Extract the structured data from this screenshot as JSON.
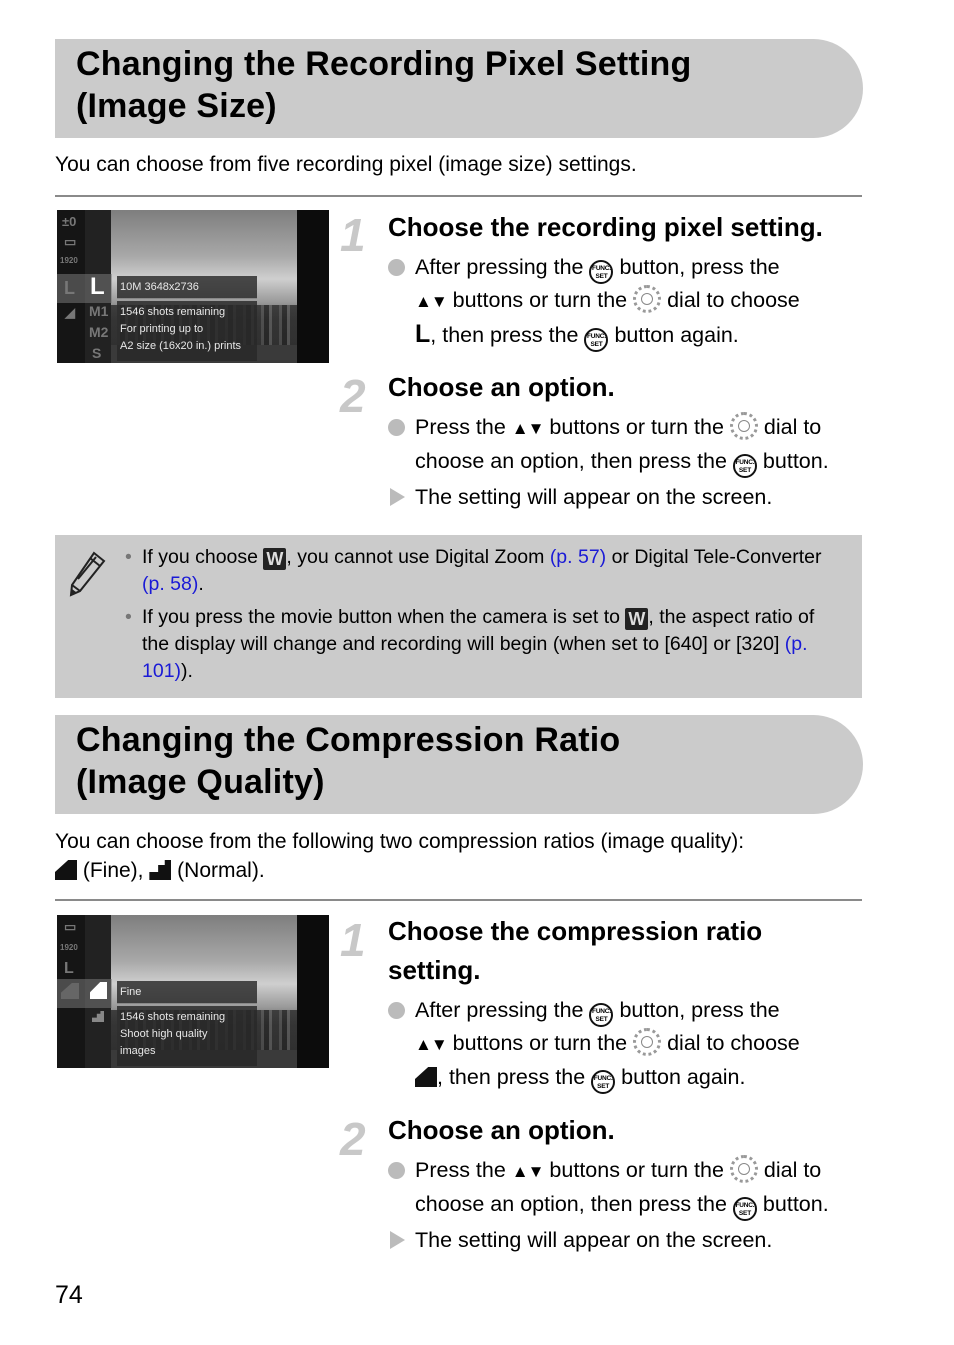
{
  "page_number": "74",
  "colors": {
    "header_bg": "#cbcbcb",
    "link": "#1a1ad6",
    "step_number": "#c8c8c8",
    "rule": "#8a8a8a"
  },
  "section1": {
    "title_line1": "Changing the Recording Pixel Setting",
    "title_line2": "(Image Size)",
    "intro": "You can choose from five recording pixel (image size) settings.",
    "screen": {
      "left_icons": [
        "±0",
        "▭",
        "1920",
        "L",
        "◢"
      ],
      "menu_options": [
        "L",
        "M1",
        "M2",
        "S"
      ],
      "selected_option": "L",
      "info_title": "10M 3648x2736",
      "info_lines": [
        "1546 shots remaining",
        "For printing up to",
        "A2 size (16x20 in.) prints"
      ]
    },
    "step1": {
      "number": "1",
      "heading": "Choose the recording pixel setting.",
      "t1": "After pressing the ",
      "t2": " button, press the",
      "t3": " buttons or turn the ",
      "t4": " dial to choose",
      "t5": ", then press the ",
      "t6": " button again.",
      "choice_glyph": "L"
    },
    "step2": {
      "number": "2",
      "heading": "Choose an option.",
      "t1": "Press the ",
      "t2": " buttons or turn the ",
      "t3": " dial to",
      "t4": "choose an option, then press the ",
      "t5": " button.",
      "result": "The setting will appear on the screen."
    }
  },
  "note": {
    "item1": {
      "t1": "If you choose ",
      "icon": "W",
      "t2": ", you cannot use Digital Zoom ",
      "link1": "(p. 57)",
      "t3": " or Digital Tele-Converter ",
      "link2": "(p. 58)",
      "t4": "."
    },
    "item2": {
      "t1": "If you press the movie button when the camera is set to ",
      "icon": "W",
      "t2": ", the aspect ratio of the display will change and recording will begin (when set to [640] or [320] ",
      "link1": "(p. 101)",
      "t3": ")."
    }
  },
  "section2": {
    "title_line1": "Changing the Compression Ratio",
    "title_line2": "(Image Quality)",
    "intro_t1": "You can choose from the following two compression ratios (image quality):",
    "intro_fine": " (Fine), ",
    "intro_normal": " (Normal).",
    "screen": {
      "left_icons": [
        "▭",
        "1920",
        "L",
        "◢"
      ],
      "menu_options": [
        "Fine",
        "Normal"
      ],
      "selected_option": "Fine",
      "info_title": "Fine",
      "info_lines": [
        "1546 shots remaining",
        "Shoot high quality",
        "images"
      ]
    },
    "step1": {
      "number": "1",
      "heading_line1": "Choose the compression ratio",
      "heading_line2": "setting.",
      "t1": "After pressing the ",
      "t2": " button, press the",
      "t3": " buttons or turn the ",
      "t4": " dial to choose",
      "t5": ", then press the ",
      "t6": " button again."
    },
    "step2": {
      "number": "2",
      "heading": "Choose an option.",
      "t1": "Press the ",
      "t2": " buttons or turn the ",
      "t3": " dial to",
      "t4": "choose an option, then press the ",
      "t5": " button.",
      "result": "The setting will appear on the screen."
    }
  },
  "icons": {
    "func_top": "FUNC.",
    "func_bottom": "SET",
    "arrows": "▲▼"
  }
}
